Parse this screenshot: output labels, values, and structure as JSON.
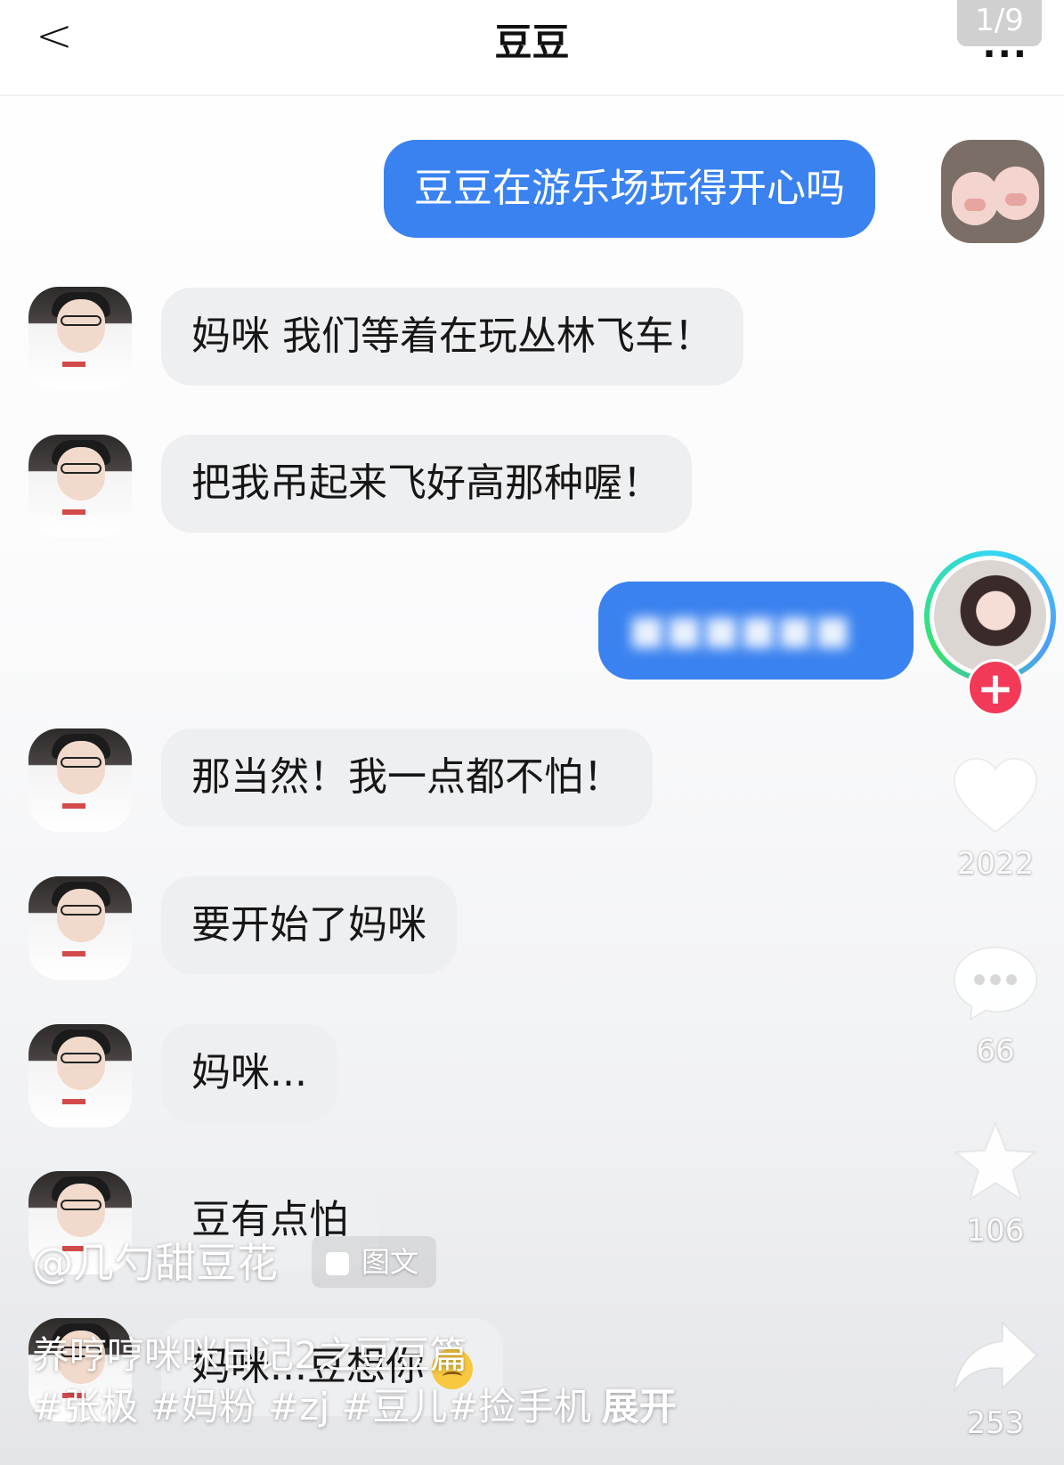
{
  "header": {
    "back_glyph": "<",
    "title": "豆豆",
    "more_glyph": "...",
    "page_counter": "1/9"
  },
  "messages": [
    {
      "side": "out",
      "text": "豆豆在游乐场玩得开心吗"
    },
    {
      "side": "in",
      "text": "妈咪 我们等着在玩丛林飞车！"
    },
    {
      "side": "in",
      "text": "把我吊起来飞好高那种喔！"
    },
    {
      "side": "out",
      "text": "",
      "blurred": true
    },
    {
      "side": "in",
      "text": "那当然！我一点都不怕！"
    },
    {
      "side": "in",
      "text": "要开始了妈咪"
    },
    {
      "side": "in",
      "text": "妈咪..."
    },
    {
      "side": "in",
      "text": "豆有点怕"
    },
    {
      "side": "in",
      "text": "妈咪...豆想你",
      "emoji": "disappointed-face"
    }
  ],
  "rail": {
    "likes": "2022",
    "comments": "66",
    "favorites": "106",
    "shares": "253"
  },
  "caption": {
    "author": "@几勺甜豆花",
    "tag_label": "图文",
    "description": "养哼哼咪咪日记2之豆豆篇",
    "hashtags": "#张极 #妈粉 #zj #豆儿#捡手机",
    "expand": "展开"
  },
  "colors": {
    "outgoing_bubble": "#3a82f0",
    "incoming_bubble": "#eeeff1",
    "follow_button": "#f23a58"
  }
}
